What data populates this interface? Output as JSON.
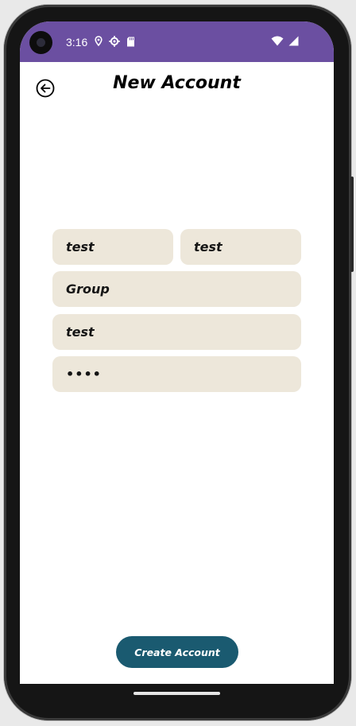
{
  "status_bar": {
    "time": "3:16",
    "left_icons": [
      "location-pin-icon",
      "gear-icon",
      "sd-card-icon"
    ],
    "right_icons": [
      "wifi-icon",
      "signal-icon"
    ],
    "color": "#6b4fa1"
  },
  "header": {
    "title": "New Account",
    "back_icon": "arrow-left-circle-icon"
  },
  "form": {
    "first_name": "test",
    "last_name": "test",
    "group": "Group",
    "username": "test",
    "password_masked": "••••"
  },
  "actions": {
    "create_label": "Create Account",
    "button_color": "#1a5a70"
  },
  "field_color": "#ede7da"
}
